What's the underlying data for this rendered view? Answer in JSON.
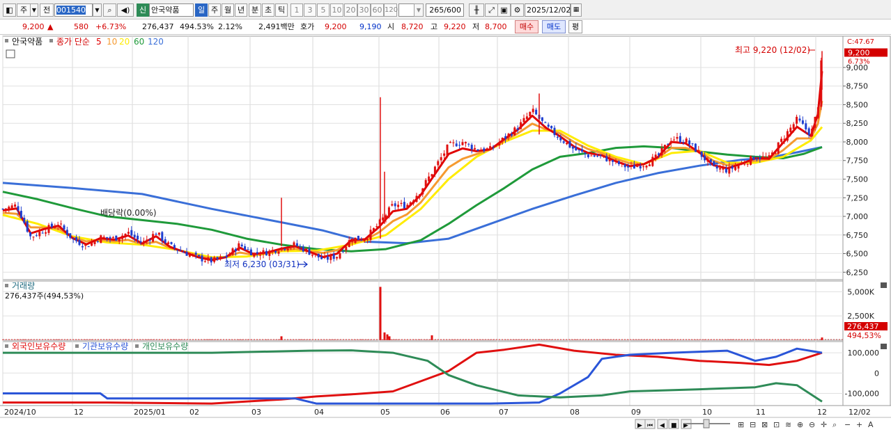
{
  "toolbar": {
    "stock_type": "주",
    "prefix": "전",
    "code": "001540",
    "badge": "신",
    "name": "안국약품",
    "periods": [
      "일",
      "주",
      "월",
      "년",
      "분",
      "초",
      "틱"
    ],
    "intervals": [
      "1",
      "3",
      "5",
      "10",
      "20",
      "30",
      "60",
      "120"
    ],
    "count": "265",
    "total": "/600",
    "date": "2025/12/02"
  },
  "info": {
    "price": "9,200",
    "arrow": "▲",
    "change": "580",
    "change_pct": "+6.73%",
    "volume": "276,437",
    "vol_ratio": "494.53%",
    "turnover": "2.12%",
    "amount": "2,491백만",
    "quote_label": "호가",
    "ask": "9,200",
    "bid": "9,190",
    "open_label": "시",
    "open": "8,720",
    "high_label": "고",
    "high": "9,220",
    "low_label": "저",
    "low": "8,700",
    "buy_btn": "매수",
    "sell_btn": "매도",
    "eval_btn": "평"
  },
  "colors": {
    "up": "#d40000",
    "ma5": "#e00000",
    "ma10": "#f59a30",
    "ma20": "#ffec00",
    "ma60": "#1f9a3a",
    "ma120": "#3a6fd8"
  },
  "chart_data": [
    {
      "type": "candlestick",
      "legend": {
        "name": "안국약품",
        "price_label": "종가 단순",
        "periods": [
          "5",
          "10",
          "20",
          "60",
          "120"
        ]
      },
      "price_axis": [
        "9,000",
        "8,750",
        "8,500",
        "8,250",
        "8,000",
        "7,750",
        "7,500",
        "7,250",
        "7,000",
        "6,750",
        "6,500",
        "6,250"
      ],
      "ylim": [
        6150,
        9420
      ],
      "axis_top": "C:47.67",
      "current_price": "9,200",
      "current_pct": "6.73%",
      "annotations": {
        "high": "최고 9,220 (12/02)",
        "low": "최저 6,230 (03/31)",
        "dividend": "배당락(0.00%)"
      },
      "x_ticks": [
        "2024/10",
        "12",
        "2025/01",
        "02",
        "03",
        "04",
        "05",
        "06",
        "07",
        "08",
        "09",
        "10",
        "11",
        "12",
        "12/02"
      ],
      "close": [
        [
          0,
          7100
        ],
        [
          20,
          7150
        ],
        [
          40,
          6720
        ],
        [
          60,
          6820
        ],
        [
          80,
          6900
        ],
        [
          100,
          6700
        ],
        [
          120,
          6600
        ],
        [
          140,
          6720
        ],
        [
          160,
          6700
        ],
        [
          180,
          6780
        ],
        [
          200,
          6640
        ],
        [
          220,
          6780
        ],
        [
          240,
          6600
        ],
        [
          260,
          6520
        ],
        [
          280,
          6440
        ],
        [
          300,
          6400
        ],
        [
          320,
          6450
        ],
        [
          340,
          6620
        ],
        [
          360,
          6500
        ],
        [
          380,
          6520
        ],
        [
          400,
          6580
        ],
        [
          420,
          6620
        ],
        [
          440,
          6520
        ],
        [
          460,
          6420
        ],
        [
          480,
          6470
        ],
        [
          500,
          6700
        ],
        [
          520,
          6700
        ],
        [
          540,
          6900
        ],
        [
          560,
          7150
        ],
        [
          580,
          7150
        ],
        [
          600,
          7350
        ],
        [
          620,
          7650
        ],
        [
          640,
          7950
        ],
        [
          660,
          8000
        ],
        [
          680,
          7900
        ],
        [
          700,
          7900
        ],
        [
          720,
          8050
        ],
        [
          740,
          8200
        ],
        [
          760,
          8420
        ],
        [
          780,
          8200
        ],
        [
          800,
          8050
        ],
        [
          820,
          7900
        ],
        [
          840,
          7820
        ],
        [
          860,
          7800
        ],
        [
          880,
          7720
        ],
        [
          900,
          7650
        ],
        [
          920,
          7700
        ],
        [
          940,
          7800
        ],
        [
          960,
          8050
        ],
        [
          980,
          8020
        ],
        [
          1000,
          7850
        ],
        [
          1020,
          7650
        ],
        [
          1040,
          7620
        ],
        [
          1060,
          7700
        ],
        [
          1080,
          7800
        ],
        [
          1100,
          7780
        ],
        [
          1120,
          8050
        ],
        [
          1140,
          8300
        ],
        [
          1160,
          8100
        ],
        [
          1170,
          8450
        ],
        [
          1176,
          9200
        ]
      ],
      "ma20": [
        [
          0,
          7020
        ],
        [
          50,
          6900
        ],
        [
          100,
          6730
        ],
        [
          150,
          6650
        ],
        [
          200,
          6620
        ],
        [
          250,
          6550
        ],
        [
          300,
          6450
        ],
        [
          350,
          6460
        ],
        [
          400,
          6530
        ],
        [
          450,
          6540
        ],
        [
          500,
          6620
        ],
        [
          550,
          6750
        ],
        [
          600,
          7100
        ],
        [
          640,
          7500
        ],
        [
          680,
          7800
        ],
        [
          720,
          8000
        ],
        [
          760,
          8150
        ],
        [
          800,
          8150
        ],
        [
          840,
          7950
        ],
        [
          880,
          7800
        ],
        [
          920,
          7700
        ],
        [
          960,
          7850
        ],
        [
          1000,
          7880
        ],
        [
          1040,
          7720
        ],
        [
          1080,
          7720
        ],
        [
          1120,
          7800
        ],
        [
          1160,
          8020
        ],
        [
          1176,
          8200
        ]
      ],
      "ma60": [
        [
          0,
          7330
        ],
        [
          50,
          7230
        ],
        [
          100,
          7110
        ],
        [
          150,
          7000
        ],
        [
          200,
          6950
        ],
        [
          250,
          6900
        ],
        [
          300,
          6820
        ],
        [
          350,
          6700
        ],
        [
          400,
          6620
        ],
        [
          450,
          6560
        ],
        [
          500,
          6530
        ],
        [
          550,
          6560
        ],
        [
          600,
          6680
        ],
        [
          640,
          6900
        ],
        [
          680,
          7150
        ],
        [
          720,
          7380
        ],
        [
          760,
          7630
        ],
        [
          800,
          7800
        ],
        [
          840,
          7850
        ],
        [
          880,
          7920
        ],
        [
          920,
          7940
        ],
        [
          960,
          7920
        ],
        [
          1000,
          7870
        ],
        [
          1040,
          7830
        ],
        [
          1080,
          7800
        ],
        [
          1120,
          7780
        ],
        [
          1150,
          7840
        ],
        [
          1176,
          7930
        ]
      ],
      "ma120": [
        [
          0,
          7450
        ],
        [
          100,
          7380
        ],
        [
          200,
          7300
        ],
        [
          300,
          7100
        ],
        [
          400,
          6920
        ],
        [
          460,
          6810
        ],
        [
          520,
          6660
        ],
        [
          580,
          6640
        ],
        [
          640,
          6700
        ],
        [
          700,
          6900
        ],
        [
          760,
          7100
        ],
        [
          820,
          7280
        ],
        [
          880,
          7450
        ],
        [
          940,
          7580
        ],
        [
          1000,
          7680
        ],
        [
          1060,
          7760
        ],
        [
          1100,
          7790
        ],
        [
          1140,
          7860
        ],
        [
          1176,
          7930
        ]
      ]
    },
    {
      "type": "bar",
      "title": "거래량",
      "subtitle": "276,437주(494,53%)",
      "axis": [
        "5,000K",
        "2,500K"
      ],
      "ylim": [
        0,
        6100
      ],
      "current_label": "276,437",
      "current_pct": "494,53%",
      "spikes": [
        [
          400,
          400
        ],
        [
          542,
          5500
        ],
        [
          548,
          800
        ],
        [
          552,
          600
        ],
        [
          555,
          400
        ],
        [
          616,
          500
        ],
        [
          1176,
          276
        ]
      ]
    },
    {
      "type": "line",
      "legend": [
        "외국인보유수량",
        "기관보유수량",
        "개인보유수량"
      ],
      "axis": [
        "100,000",
        "0",
        "-100,000"
      ],
      "ylim": [
        -160000,
        155000
      ],
      "series": [
        {
          "name": "외국인보유수량",
          "points": [
            [
              0,
              -145000
            ],
            [
              150,
              -145000
            ],
            [
              300,
              -150000
            ],
            [
              400,
              -130000
            ],
            [
              450,
              -115000
            ],
            [
              500,
              -105000
            ],
            [
              560,
              -90000
            ],
            [
              600,
              -40000
            ],
            [
              640,
              10000
            ],
            [
              680,
              100000
            ],
            [
              720,
              115000
            ],
            [
              770,
              140000
            ],
            [
              820,
              110000
            ],
            [
              880,
              90000
            ],
            [
              940,
              80000
            ],
            [
              1000,
              60000
            ],
            [
              1060,
              50000
            ],
            [
              1100,
              40000
            ],
            [
              1140,
              60000
            ],
            [
              1176,
              100000
            ]
          ]
        },
        {
          "name": "기관보유수량",
          "points": [
            [
              0,
              -100000
            ],
            [
              140,
              -100000
            ],
            [
              150,
              -125000
            ],
            [
              300,
              -125000
            ],
            [
              420,
              -125000
            ],
            [
              450,
              -150000
            ],
            [
              600,
              -150000
            ],
            [
              700,
              -150000
            ],
            [
              770,
              -145000
            ],
            [
              800,
              -100000
            ],
            [
              840,
              -20000
            ],
            [
              860,
              70000
            ],
            [
              900,
              90000
            ],
            [
              960,
              100000
            ],
            [
              1040,
              110000
            ],
            [
              1080,
              60000
            ],
            [
              1110,
              80000
            ],
            [
              1140,
              120000
            ],
            [
              1176,
              100000
            ]
          ]
        },
        {
          "name": "개인보유수량",
          "points": [
            [
              0,
              100000
            ],
            [
              150,
              100000
            ],
            [
              300,
              100000
            ],
            [
              440,
              110000
            ],
            [
              500,
              112000
            ],
            [
              560,
              100000
            ],
            [
              610,
              60000
            ],
            [
              640,
              -10000
            ],
            [
              680,
              -60000
            ],
            [
              740,
              -110000
            ],
            [
              800,
              -120000
            ],
            [
              860,
              -110000
            ],
            [
              900,
              -90000
            ],
            [
              1000,
              -80000
            ],
            [
              1080,
              -70000
            ],
            [
              1110,
              -50000
            ],
            [
              1140,
              -60000
            ],
            [
              1176,
              -140000
            ]
          ]
        }
      ]
    }
  ]
}
